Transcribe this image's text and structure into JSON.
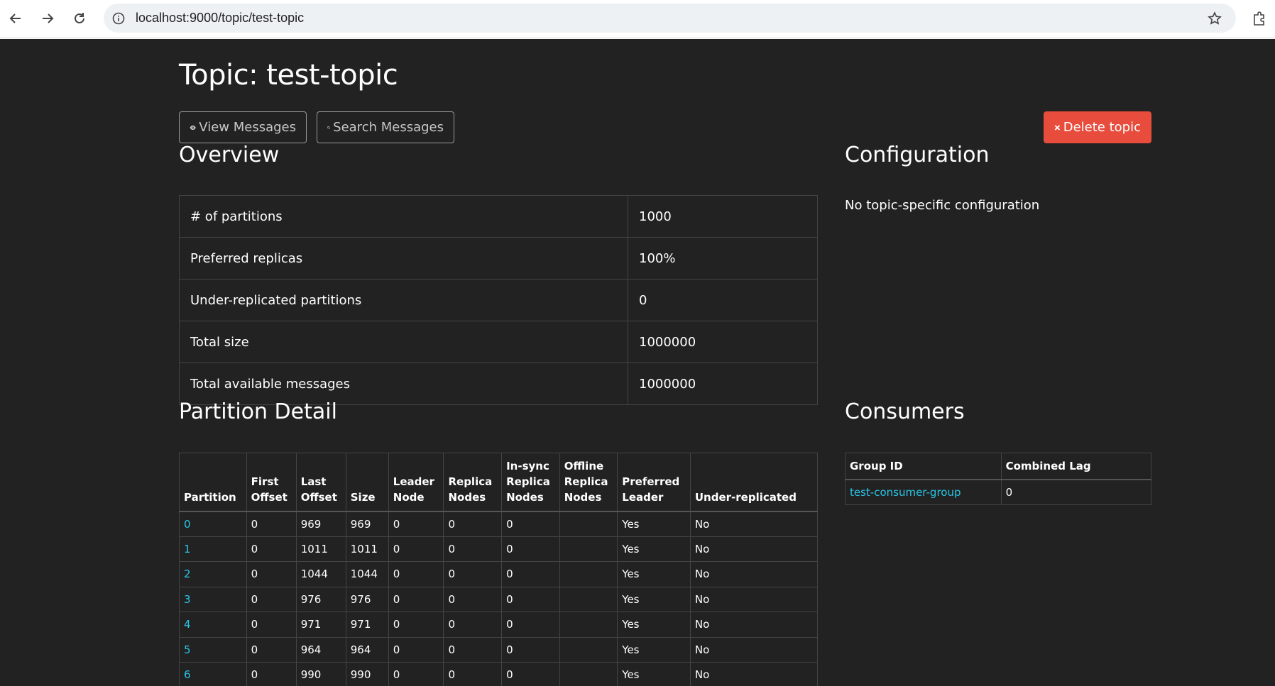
{
  "browser": {
    "url": "localhost:9000/topic/test-topic",
    "icons": [
      "back-arrow-icon",
      "forward-arrow-icon",
      "reload-icon",
      "info-icon",
      "star-icon",
      "extensions-icon"
    ]
  },
  "page": {
    "title": "Topic: test-topic",
    "buttons": {
      "view": "View Messages",
      "search": "Search Messages",
      "delete": "Delete topic"
    },
    "colors": {
      "background": "#222222",
      "link": "#29c5e6",
      "danger": "#e74c3c"
    }
  },
  "overview": {
    "heading": "Overview",
    "rows": [
      {
        "label": "# of partitions",
        "value": "1000"
      },
      {
        "label": "Preferred replicas",
        "value": "100%"
      },
      {
        "label": "Under-replicated partitions",
        "value": "0"
      },
      {
        "label": "Total size",
        "value": "1000000"
      },
      {
        "label": "Total available messages",
        "value": "1000000"
      }
    ]
  },
  "configuration": {
    "heading": "Configuration",
    "text": "No topic-specific configuration"
  },
  "partition_detail": {
    "heading": "Partition Detail",
    "columns": [
      "Partition",
      "First Offset",
      "Last Offset",
      "Size",
      "Leader Node",
      "Replica Nodes",
      "In-sync Replica Nodes",
      "Offline Replica Nodes",
      "Preferred Leader",
      "Under-replicated"
    ],
    "rows": [
      [
        "0",
        "0",
        "969",
        "969",
        "0",
        "0",
        "0",
        "",
        "Yes",
        "No"
      ],
      [
        "1",
        "0",
        "1011",
        "1011",
        "0",
        "0",
        "0",
        "",
        "Yes",
        "No"
      ],
      [
        "2",
        "0",
        "1044",
        "1044",
        "0",
        "0",
        "0",
        "",
        "Yes",
        "No"
      ],
      [
        "3",
        "0",
        "976",
        "976",
        "0",
        "0",
        "0",
        "",
        "Yes",
        "No"
      ],
      [
        "4",
        "0",
        "971",
        "971",
        "0",
        "0",
        "0",
        "",
        "Yes",
        "No"
      ],
      [
        "5",
        "0",
        "964",
        "964",
        "0",
        "0",
        "0",
        "",
        "Yes",
        "No"
      ],
      [
        "6",
        "0",
        "990",
        "990",
        "0",
        "0",
        "0",
        "",
        "Yes",
        "No"
      ]
    ]
  },
  "consumers": {
    "heading": "Consumers",
    "columns": [
      "Group ID",
      "Combined Lag"
    ],
    "rows": [
      [
        "test-consumer-group",
        "0"
      ]
    ]
  }
}
